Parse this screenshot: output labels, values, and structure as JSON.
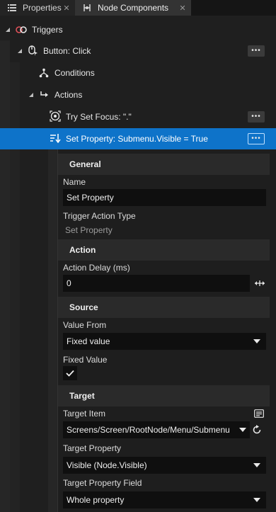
{
  "tabs": [
    {
      "label": "Properties",
      "icon": "list-icon",
      "close": "✕",
      "active": false
    },
    {
      "label": "Node Components",
      "icon": "components-icon",
      "close": "✕",
      "active": true
    }
  ],
  "tree": {
    "triggers": {
      "label": "Triggers",
      "icon": "trigger-link-icon"
    },
    "button_click": {
      "label": "Button: Click",
      "icon": "click-icon",
      "more": "•••"
    },
    "conditions": {
      "label": "Conditions",
      "icon": "conditions-icon"
    },
    "actions": {
      "label": "Actions",
      "icon": "actions-icon"
    },
    "try_set_focus": {
      "label": "Try Set Focus: \".\"",
      "icon": "focus-icon",
      "more": "•••"
    },
    "set_property": {
      "label": "Set Property: Submenu.Visible = True",
      "icon": "set-property-icon",
      "more": "•••",
      "selected": true
    }
  },
  "sections": {
    "general": {
      "title": "General",
      "name_label": "Name",
      "name_value": "Set Property",
      "type_label": "Trigger Action Type",
      "type_value": "Set Property"
    },
    "action": {
      "title": "Action",
      "delay_label": "Action Delay (ms)",
      "delay_value": "0"
    },
    "source": {
      "title": "Source",
      "value_from_label": "Value From",
      "value_from_value": "Fixed value",
      "fixed_value_label": "Fixed Value",
      "fixed_value_checked": true
    },
    "target": {
      "title": "Target",
      "item_label": "Target Item",
      "item_value": "Screens/Screen/RootNode/Menu/Submenu",
      "property_label": "Target Property",
      "property_value": "Visible (Node.Visible)",
      "field_label": "Target Property Field",
      "field_value": "Whole property"
    }
  },
  "colors": {
    "accent": "#0e73c9",
    "trigger_icon": "#e0525a"
  }
}
